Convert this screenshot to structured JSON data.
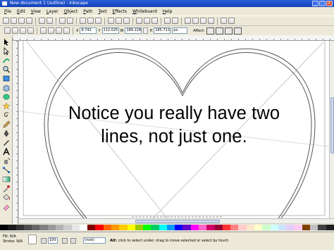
{
  "window": {
    "title": "New document 1 (outline) - Inkscape",
    "controls": [
      "_",
      "□",
      "×"
    ]
  },
  "menu": [
    "File",
    "Edit",
    "View",
    "Layer",
    "Object",
    "Path",
    "Text",
    "Effects",
    "Whiteboard",
    "Help"
  ],
  "tool_controls": {
    "x_label": "X",
    "x_value": "8.742",
    "y_label": "Y",
    "y_value": "112.025",
    "w_label": "W",
    "w_value": "186.228",
    "h_label": "H",
    "h_value": "185.713",
    "units": "px",
    "affect_label": "Affect:"
  },
  "canvas": {
    "caption_line1": "Notice you really have two",
    "caption_line2": "lines, not just one."
  },
  "status": {
    "fill_label": "Fill:",
    "fill_value": "N/A",
    "stroke_label": "Stroke:",
    "stroke_value": "N/A",
    "opacity_value": "100",
    "layer_value": "(root)",
    "message_prefix": "Alt:",
    "message_body": "click to select under; drag to move selected or select by touch"
  },
  "palette_colors": [
    "#000000",
    "#1a1a1a",
    "#333333",
    "#4d4d4d",
    "#666666",
    "#808080",
    "#999999",
    "#b3b3b3",
    "#cccccc",
    "#e6e6e6",
    "#ffffff",
    "#800000",
    "#ff0000",
    "#ff6600",
    "#ff9900",
    "#ffcc00",
    "#ffff00",
    "#99cc00",
    "#00ff00",
    "#00cc66",
    "#00ffff",
    "#0099ff",
    "#0000ff",
    "#6600cc",
    "#ff00ff",
    "#ff66cc",
    "#cc0066",
    "#990033",
    "#ff3333",
    "#ff8080",
    "#ffcccc",
    "#ffe5cc",
    "#ffffcc",
    "#ccffcc",
    "#ccffff",
    "#cce5ff",
    "#e5ccff",
    "#ffccf0",
    "#804000",
    "#c0c0c0",
    "#404040",
    "#202020"
  ]
}
